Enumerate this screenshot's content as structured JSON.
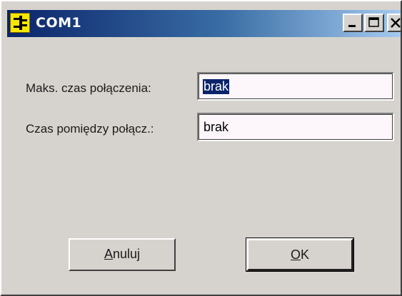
{
  "window": {
    "title": "COM1"
  },
  "fields": {
    "max_conn_label": "Maks. czas połączenia:",
    "max_conn_value": "brak",
    "between_label": "Czas pomiędzy połącz.:",
    "between_value": "brak"
  },
  "buttons": {
    "cancel_access_key": "A",
    "cancel_rest": "nuluj",
    "ok_access_key": "O",
    "ok_rest": "K"
  },
  "colors": {
    "titlebar_start": "#0a246a",
    "titlebar_end": "#a6caf0",
    "window_face": "#d6d3ce",
    "selection": "#0a246a",
    "icon_bg": "#f5e600"
  },
  "icons": {
    "app": "plug-connector-icon",
    "minimize": "minimize-icon",
    "maximize": "maximize-icon",
    "close": "close-icon"
  }
}
